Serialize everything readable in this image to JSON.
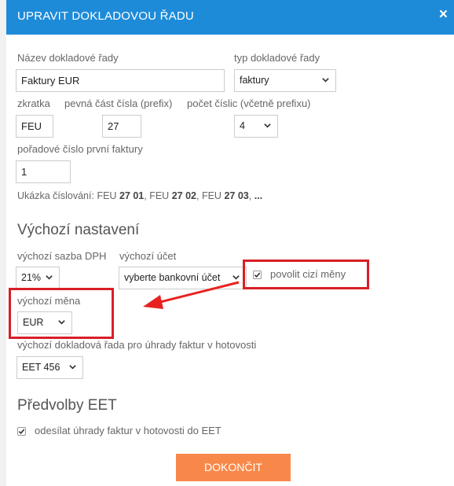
{
  "dialog": {
    "title": "UPRAVIT DOKLADOVOU ŘADU",
    "close": "×"
  },
  "fields": {
    "series_name": {
      "label": "Název dokladové řady",
      "value": "Faktury EUR"
    },
    "series_type": {
      "label": "typ dokladové řady",
      "value": "faktury"
    },
    "abbreviation": {
      "label": "zkratka",
      "value": "FEU"
    },
    "prefix": {
      "label": "pevná část čísla (prefix)",
      "value": "27"
    },
    "digits": {
      "label": "počet číslic (včetně prefixu)",
      "value": "4"
    },
    "first_number": {
      "label": "pořadové číslo první faktury",
      "value": "1"
    }
  },
  "example": {
    "label": "Ukázka číslování:",
    "items": [
      {
        "abbr": "FEU",
        "prefix": "27",
        "num": "01",
        "sep": ","
      },
      {
        "abbr": "FEU",
        "prefix": "27",
        "num": "02",
        "sep": ","
      },
      {
        "abbr": "FEU",
        "prefix": "27",
        "num": "03",
        "sep": ","
      }
    ],
    "ellipsis": "..."
  },
  "defaults": {
    "heading": "Výchozí nastavení",
    "vat_rate": {
      "label": "výchozí sazba DPH",
      "value": "21%"
    },
    "account": {
      "label": "výchozí účet",
      "value": "vyberte bankovní účet"
    },
    "foreign_currency": {
      "label": "povolit cizí měny",
      "checked": true
    },
    "currency": {
      "label": "výchozí měna",
      "value": "EUR"
    },
    "cash_series": {
      "label": "výchozí dokladová řada pro úhrady faktur v hotovosti",
      "value": "EET 456"
    }
  },
  "eet": {
    "heading": "Předvolby EET",
    "send_cash": {
      "label": "odesílat úhrady faktur v hotovosti do EET",
      "checked": true
    }
  },
  "actions": {
    "finish": "DOKONČIT"
  },
  "colors": {
    "header": "#1e8bd8",
    "highlight": "#d81f26",
    "button": "#f7884a"
  }
}
